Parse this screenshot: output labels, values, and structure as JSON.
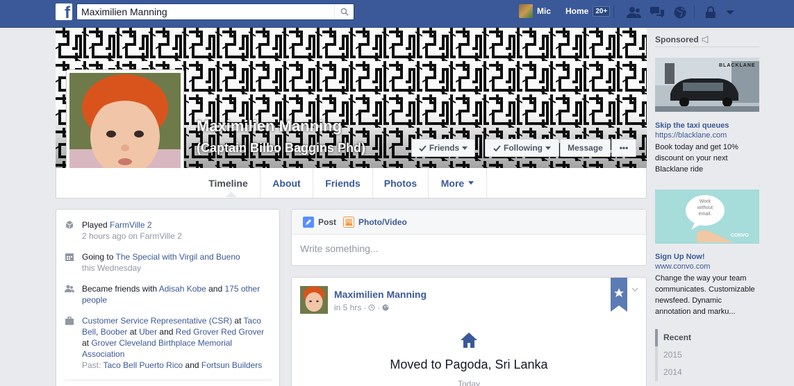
{
  "topbar": {
    "search_value": "Maximilien Manning",
    "user_name": "Mic",
    "home_label": "Home",
    "home_badge": "20+",
    "icons": [
      "friend-requests-icon",
      "messages-icon",
      "notifications-icon",
      "privacy-icon",
      "account-menu-icon"
    ]
  },
  "profile": {
    "name": "Maximilien Manning",
    "nickname": "(Captain Bilbo Baggins Phd)",
    "buttons": {
      "friends": "Friends",
      "following": "Following",
      "message": "Message",
      "more": "•••"
    }
  },
  "tabs": [
    {
      "label": "Timeline",
      "active": true
    },
    {
      "label": "About"
    },
    {
      "label": "Friends"
    },
    {
      "label": "Photos"
    },
    {
      "label": "More"
    }
  ],
  "activity": {
    "played": {
      "prefix": "Played ",
      "game": "FarmVille 2",
      "sub_time": "2 hours ago",
      "sub_on": " on FarmVille 2"
    },
    "going": {
      "prefix": "Going to ",
      "event": "The Special with Virgil and Bueno",
      "sub": "this Wednesday"
    },
    "friends": {
      "prefix": "Became friends with ",
      "person": "Adisah Kobe",
      "and": " and ",
      "others": "175 other people"
    },
    "work": {
      "job": "Customer Service Representative (CSR)",
      "at1": " at ",
      "company1": "Taco Bell",
      "sep1": ", ",
      "job2": "Boober",
      "at2": " at ",
      "company2": "Uber",
      "and": " and ",
      "job3": "Red Grover Red Grover",
      "at3": " at ",
      "company3": "Grover Cleveland Birthplace Memorial Association",
      "past_label": "Past: ",
      "past1": "Taco Bell Puerto Rico",
      "past_and": " and ",
      "past2": "Fortsun Builders"
    }
  },
  "composer": {
    "post_label": "Post",
    "photo_label": "Photo/Video",
    "placeholder": "Write something..."
  },
  "story": {
    "author": "Maximilien Manning",
    "time": "in 5 hrs",
    "sep": "·",
    "title": "Moved to Pagoda, Sri Lanka",
    "date": "Today"
  },
  "sidebar": {
    "sponsored_label": "Sponsored",
    "ads": [
      {
        "brand": "BLACKLANE",
        "title": "Skip the taxi queues",
        "url": "https://blacklane.com",
        "body": "Book today and get 10% discount on your next Blacklane ride"
      },
      {
        "bubble": "Work without email.",
        "brand": "CONVO",
        "title": "Sign Up Now!",
        "url": "www.convo.com",
        "body": "Change the way your team communicates. Customizable newsfeed. Dynamic annotation and marku..."
      }
    ],
    "years": [
      "Recent",
      "2015",
      "2014"
    ]
  },
  "colors": {
    "brand": "#3b5998",
    "background": "#e9eaed",
    "link": "#3b5998"
  }
}
